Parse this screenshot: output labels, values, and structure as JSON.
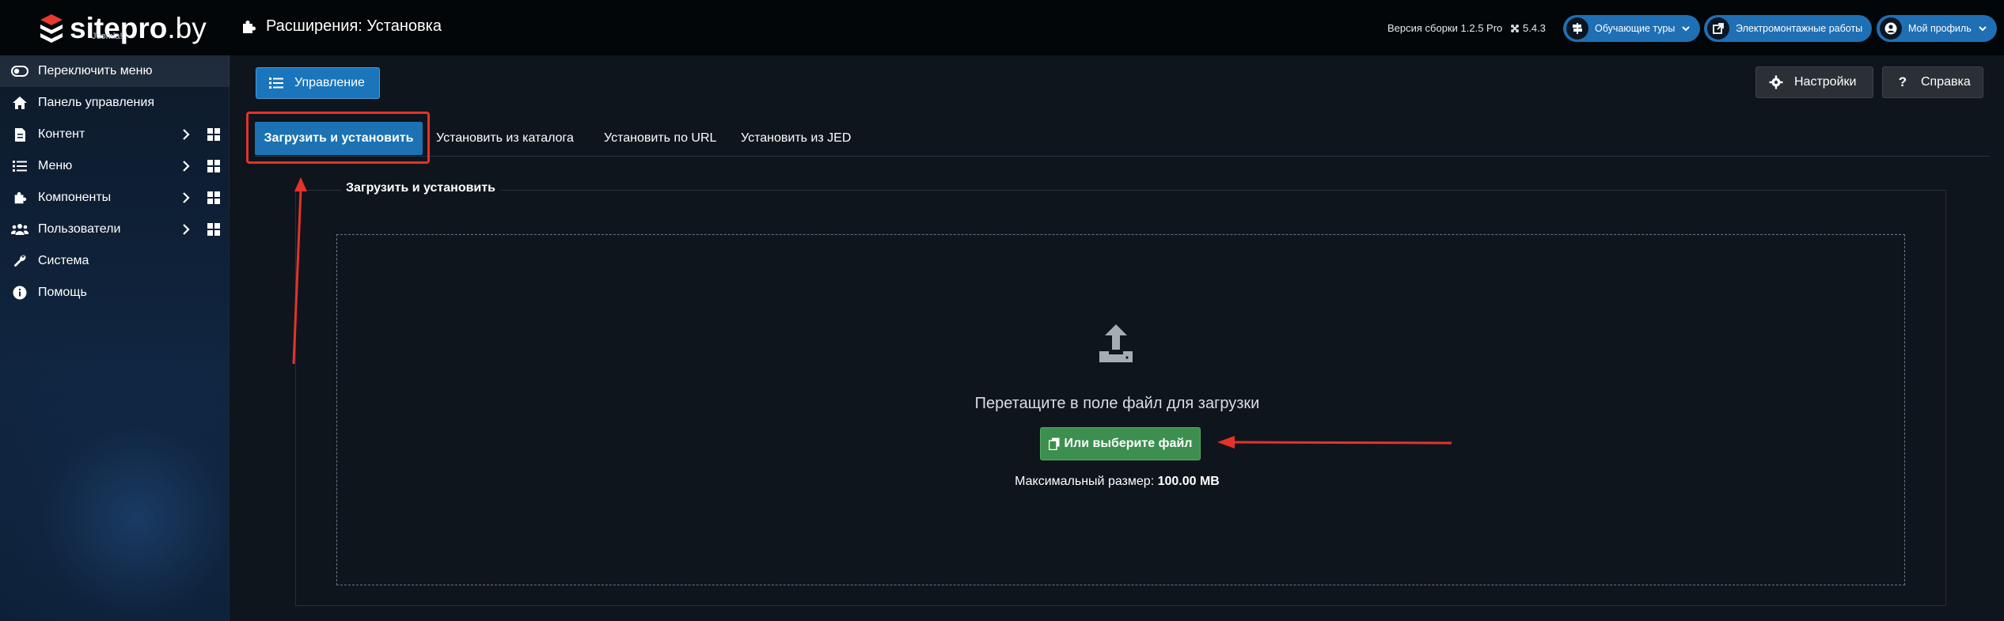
{
  "header": {
    "logo_text_main": "sitepro",
    "logo_text_domain": ".by",
    "logo_sub": "Joomla!",
    "page_title": "Расширения: Установка",
    "build_version": "Версия сборки 1.2.5 Pro",
    "joomla_version": "5.4.3",
    "tours_label": "Обучающие туры",
    "electrical_label": "Электромонтажные работы",
    "profile_label": "Мой профиль"
  },
  "sidebar": {
    "items": [
      {
        "label": "Переключить меню",
        "icon": "toggle-icon"
      },
      {
        "label": "Панель управления",
        "icon": "home-icon"
      },
      {
        "label": "Контент",
        "icon": "file-icon"
      },
      {
        "label": "Меню",
        "icon": "list-icon"
      },
      {
        "label": "Компоненты",
        "icon": "puzzle-icon"
      },
      {
        "label": "Пользователи",
        "icon": "users-icon"
      },
      {
        "label": "Система",
        "icon": "wrench-icon"
      },
      {
        "label": "Помощь",
        "icon": "info-icon"
      }
    ]
  },
  "toolbar": {
    "manage_label": "Управление",
    "settings_label": "Настройки",
    "help_label": "Справка"
  },
  "tabs": [
    {
      "label": "Загрузить и установить"
    },
    {
      "label": "Установить из каталога"
    },
    {
      "label": "Установить по URL"
    },
    {
      "label": "Установить из JED"
    }
  ],
  "upload": {
    "legend": "Загрузить и установить",
    "drop_text": "Перетащите в поле файл для загрузки",
    "choose_label": "Или выберите файл",
    "max_label": "Максимальный размер:",
    "max_value": "100.00 MB"
  },
  "colors": {
    "accent_blue": "#1c72b2",
    "button_green": "#3c8f4f",
    "highlight_red": "#e5322b",
    "header_bg": "#030608",
    "page_bg": "#0f151c"
  }
}
